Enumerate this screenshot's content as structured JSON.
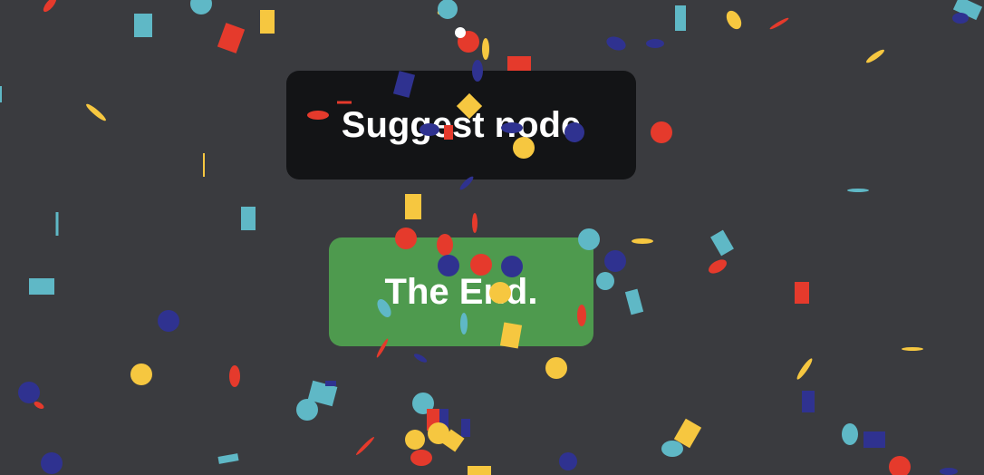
{
  "suggest_node": {
    "label": "Suggest node"
  },
  "the_end": {
    "label": "The End."
  },
  "confetti": {
    "colors": {
      "teal": "#5fb8c6",
      "red": "#e53a2c",
      "yellow": "#f6c740",
      "navy": "#2f3290"
    }
  }
}
